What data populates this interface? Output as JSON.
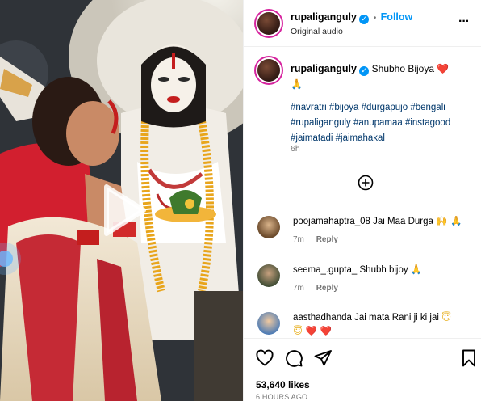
{
  "post": {
    "username": "rupaliganguly",
    "audio": "Original audio",
    "follow_label": "Follow",
    "more_label": "···",
    "dot": "•"
  },
  "caption": {
    "username": "rupaliganguly",
    "text": "Shubho Bijoya",
    "hashtags": "#navratri #bijoya #durgapujo #bengali #rupaliganguly #anupamaa #instagood #jaimatadi #jaimahakal",
    "time": "6h",
    "emoji_heart": "❤️",
    "emoji_pray": "🙏"
  },
  "comments": [
    {
      "username": "poojamahaptra_08",
      "text": "Jai Maa Durga",
      "emoji": "🙌 🙏",
      "time": "7m",
      "reply": "Reply"
    },
    {
      "username": "seema_.gupta_",
      "text": "Shubh bijoy",
      "emoji": "🙏",
      "time": "7m",
      "reply": "Reply"
    },
    {
      "username": "aasthadhanda",
      "text": "Jai mata Rani ji ki jai",
      "emoji": "😇",
      "emoji2": "😇 ❤️ ❤️",
      "time": "",
      "reply": ""
    }
  ],
  "footer": {
    "likes": "53,640 likes",
    "time_ago": "6 HOURS AGO"
  },
  "icons": {
    "verified": "verified-badge-icon",
    "play": "play-icon",
    "add_comment": "add-circle-icon",
    "like": "heart-outline-icon",
    "comment": "comment-icon",
    "share": "send-icon",
    "save": "bookmark-icon"
  },
  "colors": {
    "link": "#0095f6",
    "hashtag": "#00376b",
    "heart": "#ed4956"
  }
}
